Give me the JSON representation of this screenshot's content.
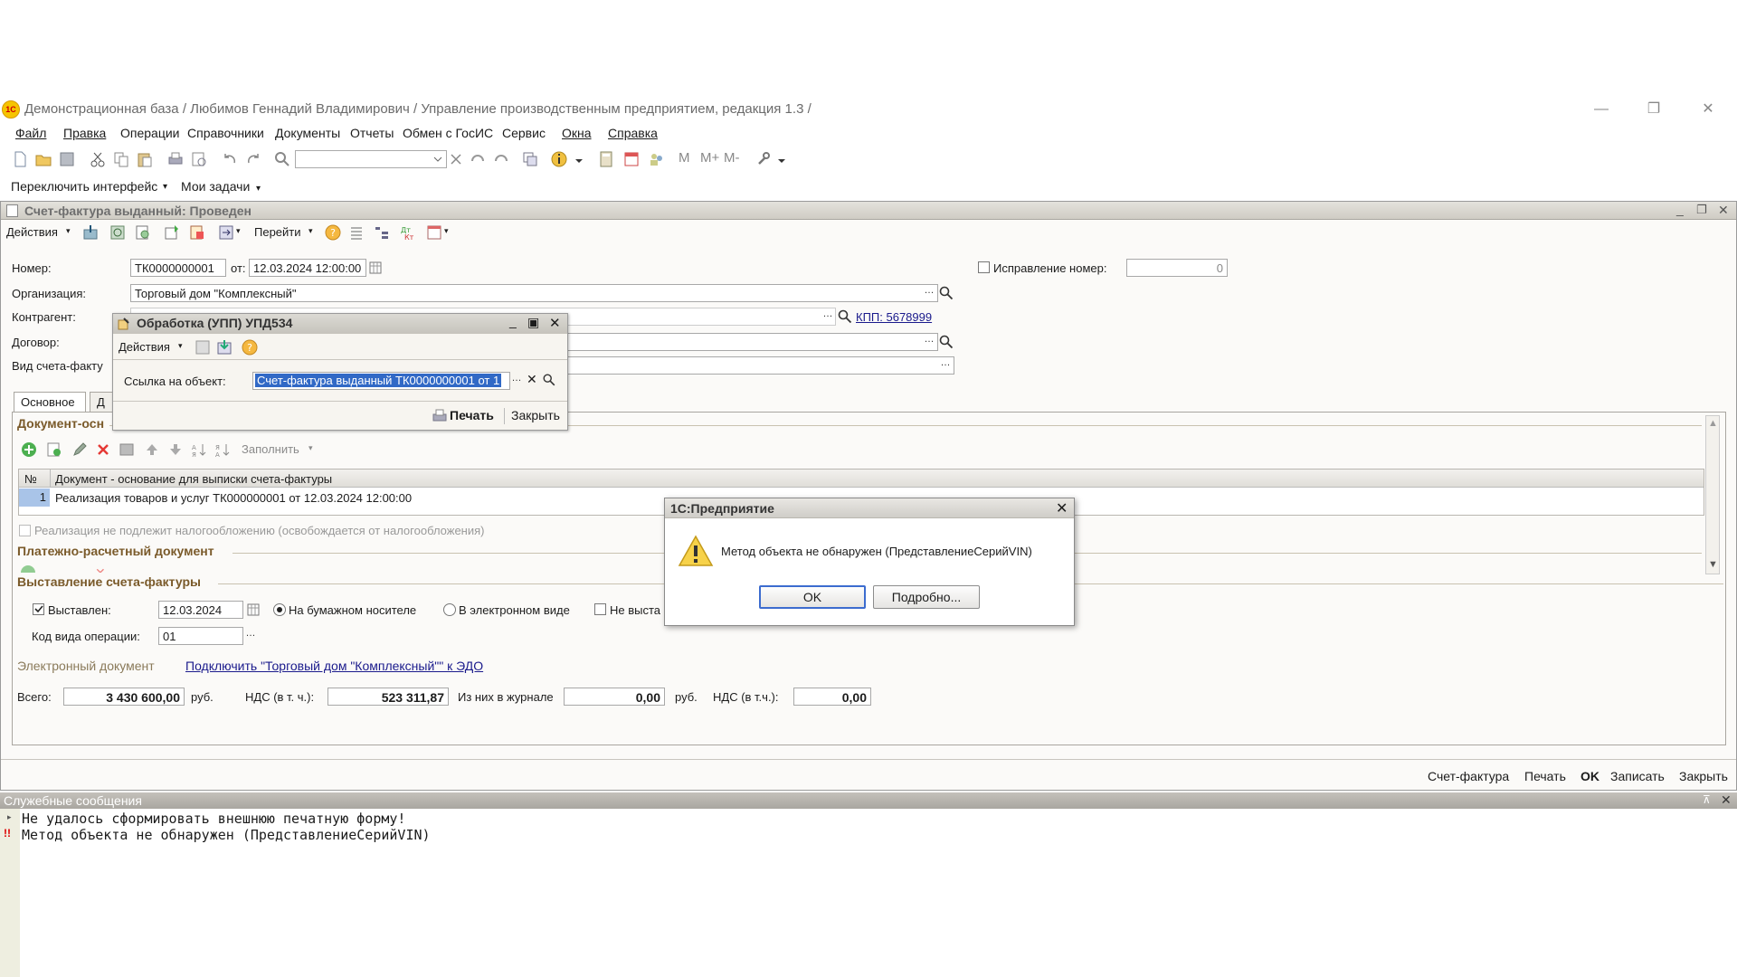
{
  "window": {
    "title": "Демонстрационная база / Любимов Геннадий Владимирович /  Управление производственным предприятием, редакция 1.3 /",
    "min": "—",
    "max": "❐",
    "close": "✕"
  },
  "menu": [
    "Файл",
    "Правка",
    "Операции",
    "Справочники",
    "Документы",
    "Отчеты",
    "Обмен с ГосИС",
    "Сервис",
    "Окна",
    "Справка"
  ],
  "toolbar2": {
    "switch_interface": "Переключить интерфейс",
    "my_tasks": "Мои задачи"
  },
  "calc": {
    "m": "M",
    "mplus": "M+",
    "mminus": "M-"
  },
  "doc": {
    "title": "Счет-фактура выданный: Проведен",
    "toolbar": {
      "actions": "Действия",
      "goto": "Перейти"
    },
    "number_label": "Номер:",
    "number_value": "ТК0000000001",
    "from_label": "от:",
    "date_value": "12.03.2024 12:00:00",
    "correction_label": "Исправление номер:",
    "correction_value": "0",
    "org_label": "Организация:",
    "org_value": "Торговый дом \"Комплексный\"",
    "contractor_label": "Контрагент:",
    "kpp_link": "КПП: 5678999",
    "contract_label": "Договор:",
    "invoice_kind_label": "Вид счета-факту",
    "tabs": [
      "Основное",
      "Д"
    ],
    "basis_section": "Документ-осн",
    "fill_label": "Заполнить",
    "table_headers": [
      "№",
      "Документ - основание для выписки счета-фактуры"
    ],
    "table_rows": [
      {
        "n": "1",
        "doc": "Реализация товаров и услуг ТК000000001 от 12.03.2024 12:00:00"
      }
    ],
    "not_taxable": "Реализация не подлежит налогообложению (освобождается от налогообложения)",
    "payment_section": "Платежно-расчетный документ",
    "issue_section": "Выставление счета-фактуры",
    "issued_label": "Выставлен:",
    "issued_date": "12.03.2024",
    "paper_label": "На бумажном носителе",
    "electronic_label": "В электронном виде",
    "not_issued_label": "Не выста",
    "op_code_label": "Код вида операции:",
    "op_code_value": "01",
    "edoc_label": "Электронный документ",
    "edo_link": "Подключить \"Торговый дом \"Комплексный\"\" к ЭДО",
    "total_label": "Всего:",
    "total_value": "3 430 600,00",
    "rub1": "руб.",
    "vat_label": "НДС (в т. ч.):",
    "vat_value": "523 311,87",
    "journal_label": "Из них в журнале",
    "journal_value": "0,00",
    "rub2": "руб.",
    "vat2_label": "НДС (в т.ч.):",
    "vat2_value": "0,00",
    "actions": [
      "Счет-фактура",
      "Печать",
      "OK",
      "Записать",
      "Закрыть"
    ]
  },
  "processing": {
    "title": "Обработка  (УПП) УПД534",
    "actions": "Действия",
    "link_label": "Ссылка на объект:",
    "link_value": "Счет-фактура выданный ТК0000000001 от 1",
    "print": "Печать",
    "close": "Закрыть"
  },
  "msgbox": {
    "title": "1С:Предприятие",
    "text": "Метод объекта не обнаружен (ПредставлениеСерийVIN)",
    "ok": "OK",
    "details": "Подробно..."
  },
  "messages": {
    "title": "Служебные сообщения",
    "lines": [
      "Не удалось сформировать внешнюю печатную форму!",
      "Метод объекта не обнаружен (ПредставлениеСерийVIN)"
    ]
  }
}
